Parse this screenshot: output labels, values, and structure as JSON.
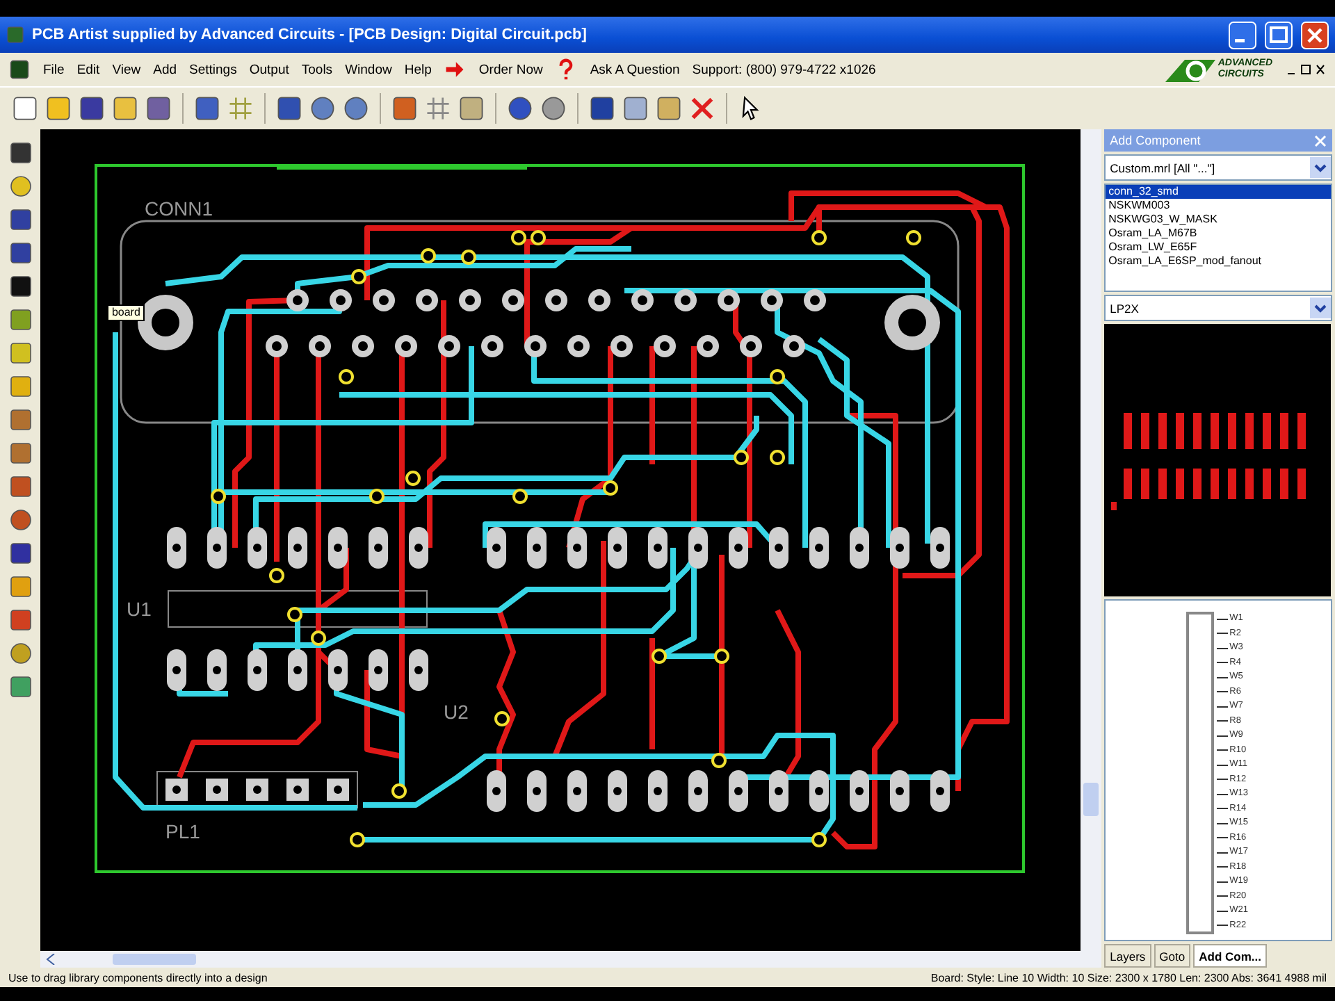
{
  "window": {
    "title": "PCB Artist supplied by Advanced Circuits - [PCB Design: Digital Circuit.pcb]"
  },
  "menu": {
    "items": [
      "File",
      "Edit",
      "View",
      "Add",
      "Settings",
      "Output",
      "Tools",
      "Window",
      "Help"
    ],
    "order": "Order Now",
    "ask": "Ask A Question",
    "support": "Support: (800) 979-4722 x1026",
    "logo": [
      "ADVANCED",
      "CIRCUITS"
    ]
  },
  "board": {
    "labels": [
      {
        "text": "CONN1",
        "kind": "silk"
      },
      {
        "text": "U1",
        "kind": "silk"
      },
      {
        "text": "U2",
        "kind": "silk"
      },
      {
        "text": "PL1",
        "kind": "silk"
      },
      {
        "text": "board",
        "kind": "tip"
      }
    ]
  },
  "panel": {
    "title": "Add Component",
    "library": "Custom.mrl  [All \"...\"]",
    "components": [
      {
        "name": "conn_32_smd",
        "selected": true
      },
      {
        "name": "NSKWM003",
        "selected": false
      },
      {
        "name": "NSKWG03_W_MASK",
        "selected": false
      },
      {
        "name": "Osram_LA_M67B",
        "selected": false
      },
      {
        "name": "Osram_LW_E65F",
        "selected": false
      },
      {
        "name": "Osram_LA_E6SP_mod_fanout",
        "selected": false
      }
    ],
    "package": "LP2X",
    "pins": [
      "W1",
      "R2",
      "W3",
      "R4",
      "W5",
      "R6",
      "W7",
      "R8",
      "W9",
      "R10",
      "W11",
      "R12",
      "W13",
      "R14",
      "W15",
      "R16",
      "W17",
      "R18",
      "W19",
      "R20",
      "W21",
      "R22"
    ],
    "tabs": [
      {
        "label": "Layers",
        "selected": false
      },
      {
        "label": "Goto",
        "selected": false
      },
      {
        "label": "Add Com...",
        "selected": true
      }
    ]
  },
  "status": {
    "hint": "Use to drag library components directly into a design",
    "info": "Board: Style: Line 10 Width: 10 Size: 2300 x 1780 Len: 2300 Abs: 3641 4988 mil"
  }
}
